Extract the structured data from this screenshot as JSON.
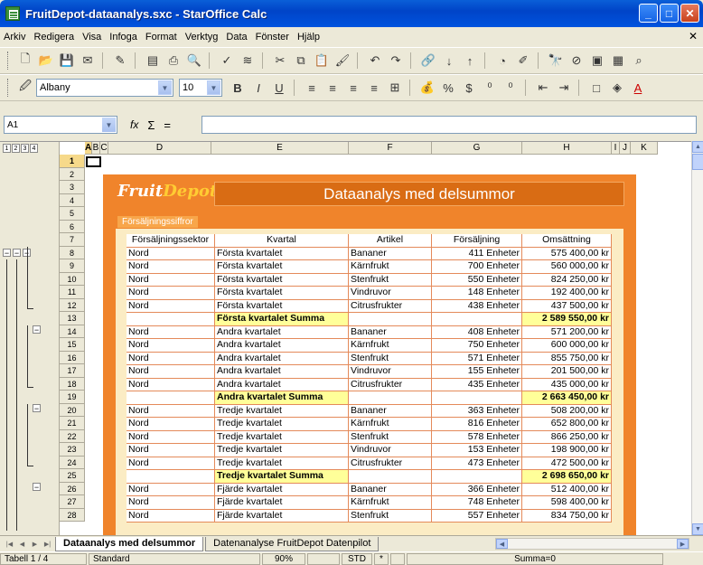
{
  "window": {
    "title": "FruitDepot-dataanalys.sxc - StarOffice Calc"
  },
  "menu": [
    "Arkiv",
    "Redigera",
    "Visa",
    "Infoga",
    "Format",
    "Verktyg",
    "Data",
    "Fönster",
    "Hjälp"
  ],
  "toolbar2": {
    "font_name": "Albany",
    "font_size": "10"
  },
  "formula": {
    "cell_ref": "A1",
    "content": ""
  },
  "columns": [
    "A",
    "B",
    "C",
    "D",
    "E",
    "F",
    "G",
    "H",
    "I",
    "J",
    "K"
  ],
  "rows": [
    "1",
    "2",
    "3",
    "4",
    "5",
    "6",
    "7",
    "8",
    "9",
    "10",
    "11",
    "12",
    "13",
    "14",
    "15",
    "16",
    "17",
    "18",
    "19",
    "20",
    "21",
    "22",
    "23",
    "24",
    "25",
    "26",
    "27",
    "28"
  ],
  "outline_levels": [
    "1",
    "2",
    "3",
    "4"
  ],
  "sheet": {
    "logo_text_1": "Fruit",
    "logo_text_2": "Depot",
    "banner": "Dataanalys med delsummor",
    "section_label": "Försäljningssiffror",
    "headers": [
      "Försäljningssektor",
      "Kvartal",
      "Artikel",
      "Försäljning",
      "Omsättning"
    ],
    "data_rows": [
      [
        "Nord",
        "Första kvartalet",
        "Bananer",
        "411 Enheter",
        "575 400,00 kr"
      ],
      [
        "Nord",
        "Första kvartalet",
        "Kärnfrukt",
        "700 Enheter",
        "560 000,00 kr"
      ],
      [
        "Nord",
        "Första kvartalet",
        "Stenfrukt",
        "550 Enheter",
        "824 250,00 kr"
      ],
      [
        "Nord",
        "Första kvartalet",
        "Vindruvor",
        "148 Enheter",
        "192 400,00 kr"
      ],
      [
        "Nord",
        "Första kvartalet",
        "Citrusfrukter",
        "438 Enheter",
        "437 500,00 kr"
      ],
      [
        "",
        "Första kvartalet Summa",
        "",
        "",
        "2 589 550,00 kr"
      ],
      [
        "Nord",
        "Andra kvartalet",
        "Bananer",
        "408 Enheter",
        "571 200,00 kr"
      ],
      [
        "Nord",
        "Andra kvartalet",
        "Kärnfrukt",
        "750 Enheter",
        "600 000,00 kr"
      ],
      [
        "Nord",
        "Andra kvartalet",
        "Stenfrukt",
        "571 Enheter",
        "855 750,00 kr"
      ],
      [
        "Nord",
        "Andra kvartalet",
        "Vindruvor",
        "155 Enheter",
        "201 500,00 kr"
      ],
      [
        "Nord",
        "Andra kvartalet",
        "Citrusfrukter",
        "435 Enheter",
        "435 000,00 kr"
      ],
      [
        "",
        "Andra kvartalet Summa",
        "",
        "",
        "2 663 450,00 kr"
      ],
      [
        "Nord",
        "Tredje kvartalet",
        "Bananer",
        "363 Enheter",
        "508 200,00 kr"
      ],
      [
        "Nord",
        "Tredje kvartalet",
        "Kärnfrukt",
        "816 Enheter",
        "652 800,00 kr"
      ],
      [
        "Nord",
        "Tredje kvartalet",
        "Stenfrukt",
        "578 Enheter",
        "866 250,00 kr"
      ],
      [
        "Nord",
        "Tredje kvartalet",
        "Vindruvor",
        "153 Enheter",
        "198 900,00 kr"
      ],
      [
        "Nord",
        "Tredje kvartalet",
        "Citrusfrukter",
        "473 Enheter",
        "472 500,00 kr"
      ],
      [
        "",
        "Tredje kvartalet Summa",
        "",
        "",
        "2 698 650,00 kr"
      ],
      [
        "Nord",
        "Fjärde kvartalet",
        "Bananer",
        "366 Enheter",
        "512 400,00 kr"
      ],
      [
        "Nord",
        "Fjärde kvartalet",
        "Kärnfrukt",
        "748 Enheter",
        "598 400,00 kr"
      ],
      [
        "Nord",
        "Fjärde kvartalet",
        "Stenfrukt",
        "557 Enheter",
        "834 750,00 kr"
      ]
    ]
  },
  "tabs": [
    "Dataanalys med delsummor",
    "Datenanalyse FruitDepot Datenpilot"
  ],
  "status": {
    "sheet": "Tabell 1 / 4",
    "style": "Standard",
    "zoom": "90%",
    "mode": "STD",
    "modified": "*",
    "sum": "Summa=0"
  }
}
